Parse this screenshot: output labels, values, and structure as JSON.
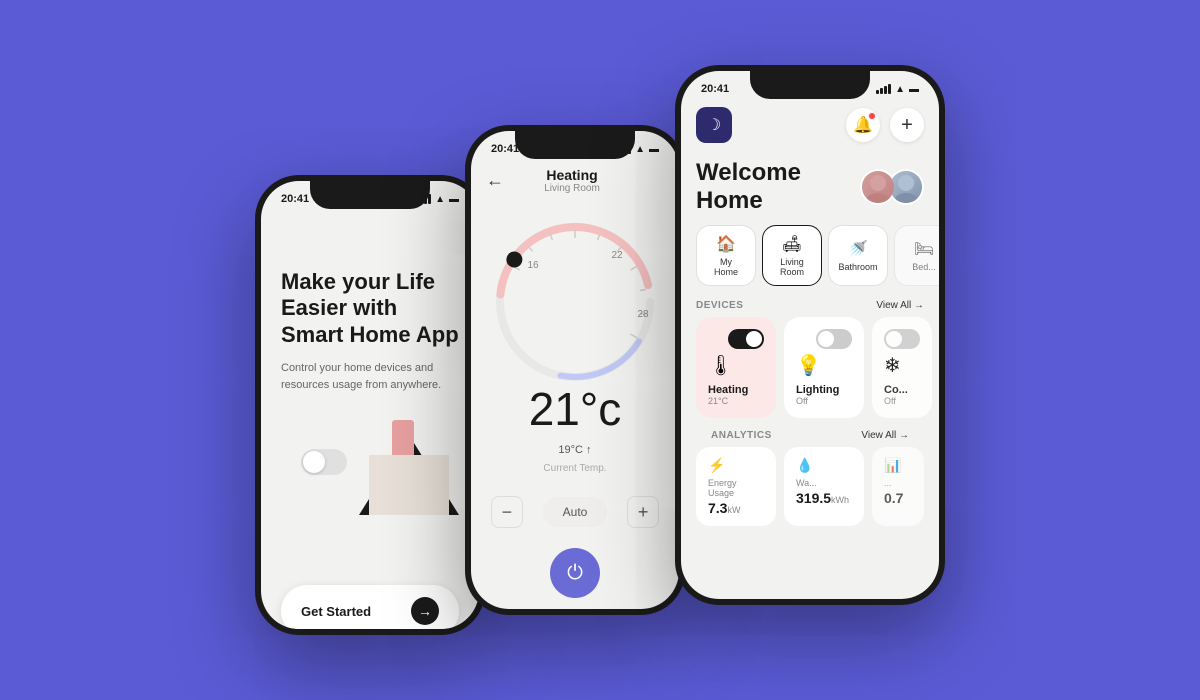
{
  "app": {
    "background": "#5B5BD6"
  },
  "phone1": {
    "status_time": "20:41",
    "title": "Make your Life Easier with Smart Home App",
    "subtitle": "Control your home devices and resources usage from anywhere.",
    "cta_label": "Get Started",
    "cta_arrow": "→"
  },
  "phone2": {
    "status_time": "20:41",
    "back_icon": "←",
    "page_title": "Heating",
    "page_subtitle": "Living Room",
    "temperature": "21°c",
    "current_temp": "19°C ↑",
    "current_temp_label": "Current Temp.",
    "scale_min": "16",
    "scale_max1": "22",
    "scale_max2": "28",
    "mode_label": "Auto",
    "minus_label": "−",
    "power_icon": "⏻"
  },
  "phone3": {
    "status_time": "20:41",
    "welcome_title": "Welcome Home",
    "app_icon": "☽",
    "notification_icon": "🔔",
    "add_icon": "+",
    "rooms": [
      {
        "icon": "🏠",
        "label": "My Home",
        "active": false
      },
      {
        "icon": "🛋",
        "label": "Living Room",
        "active": true
      },
      {
        "icon": "🚿",
        "label": "Bathroom",
        "active": false
      },
      {
        "icon": "🛏",
        "label": "Bedroom",
        "active": false
      }
    ],
    "devices_section_label": "DEVICES",
    "devices_view_all": "View All →",
    "devices": [
      {
        "name": "Heating",
        "status": "21°C",
        "icon": "🌡",
        "on": true,
        "card_type": "heating"
      },
      {
        "name": "Lighting",
        "status": "Off",
        "icon": "💡",
        "on": false,
        "card_type": "normal"
      },
      {
        "name": "Co...",
        "status": "Off",
        "icon": "❄",
        "on": false,
        "card_type": "normal"
      }
    ],
    "analytics_section_label": "ANALYTICS",
    "analytics_view_all": "View All →",
    "analytics": [
      {
        "icon": "⚡",
        "label": "Energy Usage",
        "value": "7.3",
        "unit": "kW"
      },
      {
        "icon": "💧",
        "label": "Wa...",
        "value": "319.5",
        "unit": "kWh"
      },
      {
        "icon": "...",
        "label": "...",
        "value": "0.7",
        "unit": ""
      }
    ]
  }
}
